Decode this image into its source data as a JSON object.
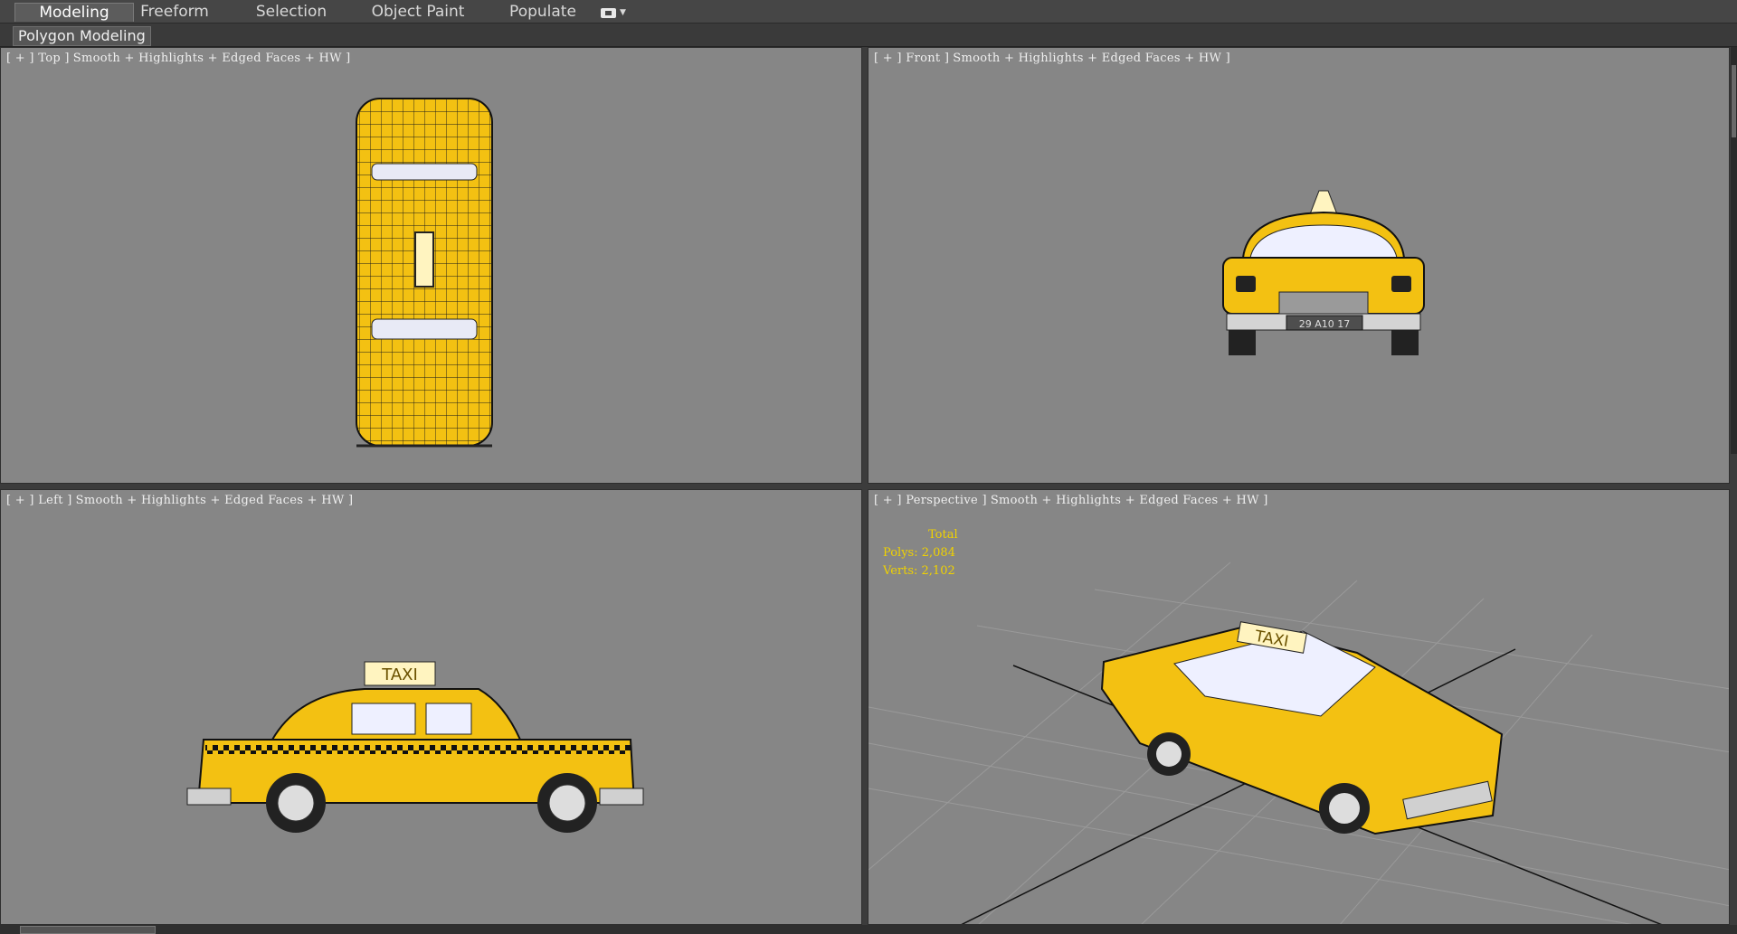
{
  "ribbon": {
    "tabs": [
      {
        "label": "Modeling",
        "active": true
      },
      {
        "label": "Freeform",
        "active": false
      },
      {
        "label": "Selection",
        "active": false
      },
      {
        "label": "Object Paint",
        "active": false
      },
      {
        "label": "Populate",
        "active": false
      }
    ],
    "panel_label": "Polygon Modeling"
  },
  "viewports": {
    "top": {
      "plus": "[ + ]",
      "name": "Top",
      "shading": "Smooth + Highlights + Edged Faces + HW ]"
    },
    "front": {
      "plus": "[ + ]",
      "name": "Front",
      "shading": "Smooth + Highlights + Edged Faces + HW ]",
      "plate": "29 A10 17"
    },
    "left": {
      "plus": "[ + ]",
      "name": "Left",
      "shading": "Smooth + Highlights + Edged Faces + HW ]",
      "sign": "TAXI"
    },
    "perspective": {
      "plus": "[ + ]",
      "name": "Perspective",
      "shading": "Smooth + Highlights + Edged Faces + HW ]",
      "sign": "TAXI",
      "stats": {
        "title": "Total",
        "polys_label": "Polys:",
        "polys_value": "2,084",
        "verts_label": "Verts:",
        "verts_value": "2,102"
      }
    }
  },
  "colors": {
    "viewport_bg": "#868686",
    "taxi_yellow": "#f3c112",
    "stats_text": "#f0d200",
    "label_text": "#efefef"
  }
}
